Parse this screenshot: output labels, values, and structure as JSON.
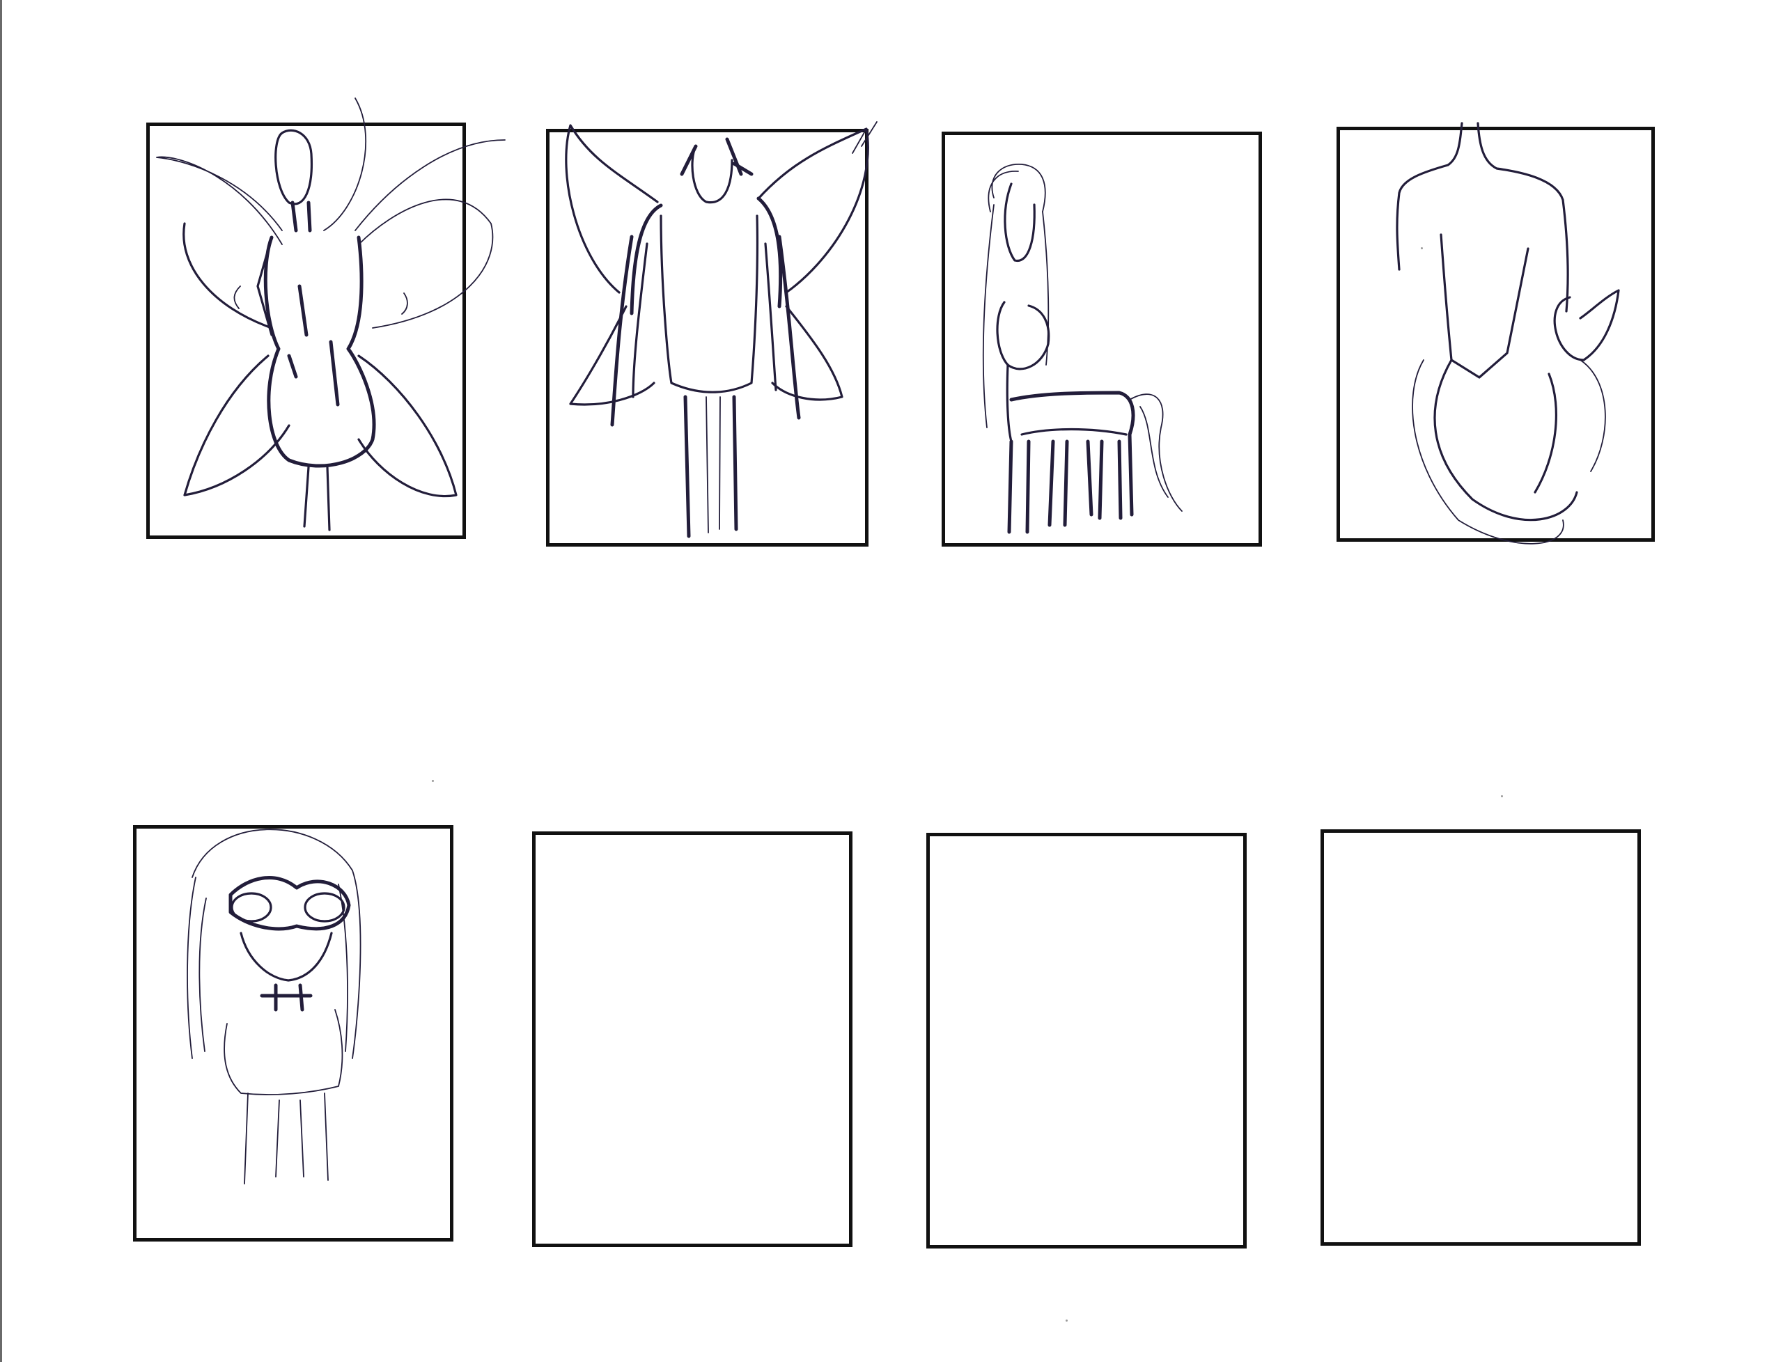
{
  "sheet": {
    "background": "#ffffff",
    "border_color": "#111111",
    "pencil_color": "#221d3a"
  },
  "panels": [
    {
      "subject": "winged-fairy-sketch",
      "state": "drawn"
    },
    {
      "subject": "winged-figure-sketch",
      "state": "drawn"
    },
    {
      "subject": "centaur-sketch",
      "state": "drawn"
    },
    {
      "subject": "mermaid-sketch",
      "state": "drawn"
    },
    {
      "subject": "masked-girl-sketch",
      "state": "drawn"
    },
    {
      "subject": "",
      "state": "empty"
    },
    {
      "subject": "",
      "state": "empty"
    },
    {
      "subject": "",
      "state": "empty"
    }
  ]
}
